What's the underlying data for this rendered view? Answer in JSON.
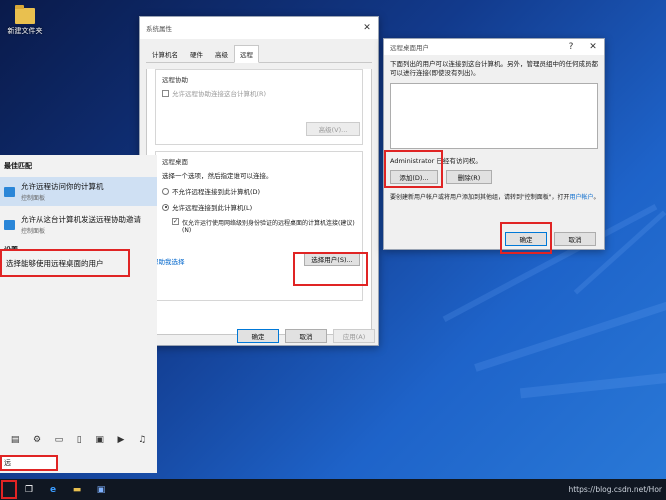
{
  "desktop": {
    "folder_label": "新建文件夹"
  },
  "sysprops": {
    "title": "系统属性",
    "tabs": [
      "计算机名",
      "硬件",
      "高级",
      "远程"
    ],
    "assist": {
      "group_title": "远程协助",
      "checkbox_label": "允许远程协助连接这台计算机(R)",
      "advanced_button": "高级(V)..."
    },
    "desktop": {
      "group_title": "远程桌面",
      "hint": "选择一个选项，然后指定谁可以连接。",
      "option_deny": "不允许远程连接到此计算机(D)",
      "option_allow": "允许远程连接到此计算机(L)",
      "nla_line1": "仅允许运行使用网络级别身份验证的远程桌面的计算机连接(建议)",
      "nla_line2": "(N)",
      "help_link": "帮助我选择",
      "select_users_button": "选择用户(S)..."
    },
    "ok": "确定",
    "cancel": "取消",
    "apply": "应用(A)"
  },
  "rdusers": {
    "title": "远程桌面用户",
    "help_icon": "?",
    "description": "下面列出的用户可以连接到这台计算机。另外，管理员组中的任何成员都可以进行连接(即使没有列出)。",
    "access_text": "Administrator 已经有访问权。",
    "add_button": "添加(D)...",
    "remove_button": "删除(R)",
    "footer_text": "要创建新用户帐户或将用户添加到其他组，请转到\"控制面板\"，打开",
    "footer_link": "用户帐户",
    "footer_end": "。",
    "ok": "确定",
    "cancel": "取消"
  },
  "startmenu": {
    "best_match": "最佳匹配",
    "items": [
      {
        "title": "允许远程访问你的计算机",
        "sub": "控制面板"
      },
      {
        "title": "允许从这台计算机发送远程协助邀请",
        "sub": "控制面板"
      }
    ],
    "settings_heading": "设置",
    "setting_item": "选择能够使用远程桌面的用户",
    "search_text": "远"
  },
  "taskbar": {
    "watermark": "https://blog.csdn.net/Hor"
  }
}
